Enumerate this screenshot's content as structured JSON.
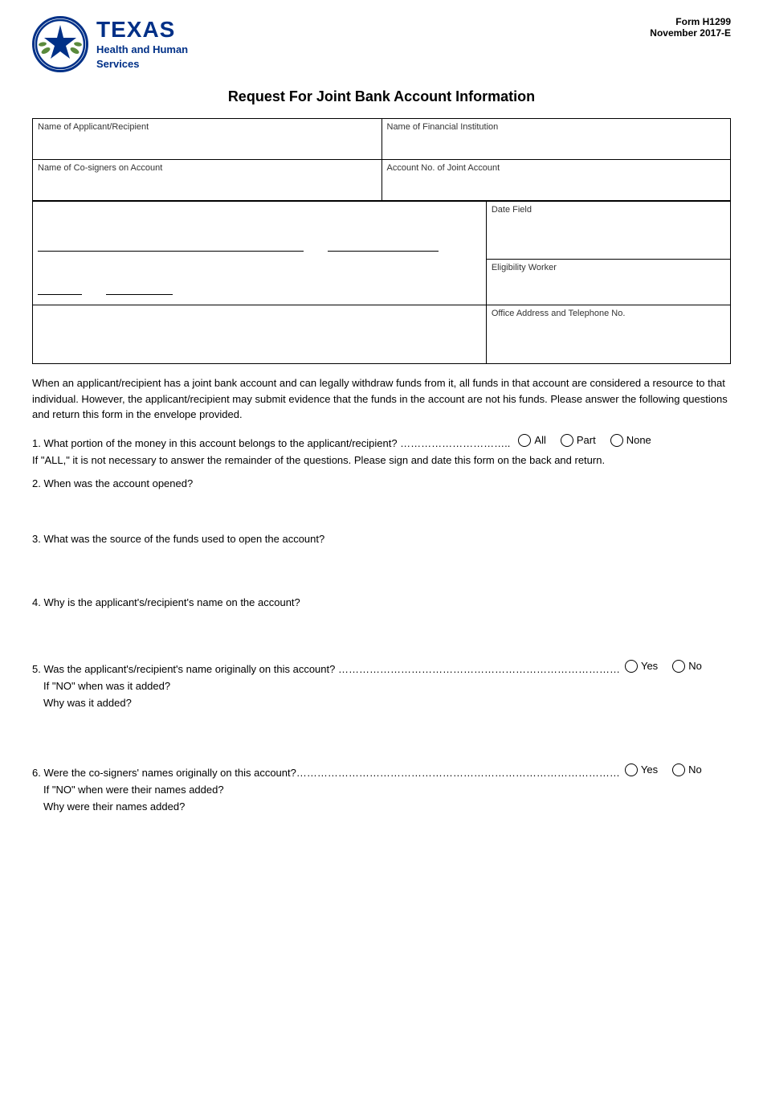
{
  "header": {
    "org_line1": "TEXAS",
    "org_line2": "Health and Human",
    "org_line3": "Services",
    "form_id": "Form H1299",
    "form_date": "November 2017-E"
  },
  "title": "Request For Joint Bank Account Information",
  "fields": {
    "applicant_label": "Name of Applicant/Recipient",
    "financial_institution_label": "Name of Financial Institution",
    "cosigners_label": "Name of Co-signers on Account",
    "account_no_label": "Account No. of Joint Account",
    "date_field_label": "Date Field",
    "eligibility_worker_label": "Eligibility Worker",
    "office_address_label": "Office Address and Telephone No."
  },
  "body_text": "When an applicant/recipient has a joint bank account and can legally withdraw funds from it, all funds in that account are considered a resource to that individual. However, the applicant/recipient may submit evidence that the funds in the account are not his funds. Please answer the following questions and return this form in the envelope provided.",
  "questions": [
    {
      "num": "1.",
      "text": "What portion of the money in this account belongs to the applicant/recipient?",
      "dots": "…………………………….",
      "options": [
        "All",
        "Part",
        "None"
      ],
      "has_subnote": true,
      "subnote": "If \"ALL,\" it is not necessary to answer the remainder of the questions. Please sign and date this form on the back and return."
    },
    {
      "num": "2.",
      "text": "When was the account opened?",
      "options": null
    },
    {
      "num": "3.",
      "text": "What was the source of the funds used to open the account?",
      "options": null
    },
    {
      "num": "4.",
      "text": "Why is the applicant's/recipient's name on the account?",
      "options": null
    },
    {
      "num": "5.",
      "text": "Was the applicant's/recipient's name originally on this account?",
      "dots": "……………………………………………………………………………",
      "options": [
        "Yes",
        "No"
      ],
      "if_no_label": "If \"NO\" when was it added?",
      "why_label": "Why was it added?"
    },
    {
      "num": "6.",
      "text": "Were the co-signers' names originally on this account?",
      "dots": "………………………………………………………………………………………",
      "options": [
        "Yes",
        "No"
      ],
      "if_no_label": "If \"NO\" when were their names added?",
      "why_label": "Why were their names added?"
    }
  ]
}
